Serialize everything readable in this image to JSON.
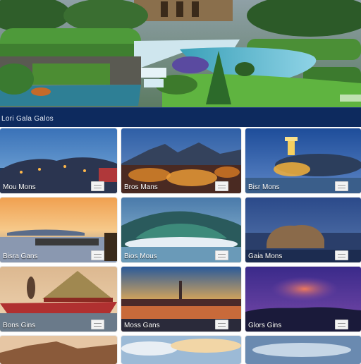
{
  "banner": {
    "title": "Lori Gala Galos"
  },
  "cards": [
    {
      "caption": "Mou Mons"
    },
    {
      "caption": "Bros Mans"
    },
    {
      "caption": "Bisr Mons"
    },
    {
      "caption": "Bisra Gans"
    },
    {
      "caption": "Bios Mous"
    },
    {
      "caption": "Gaia Mons"
    },
    {
      "caption": "Bons Gins"
    },
    {
      "caption": "Moss Gans"
    },
    {
      "caption": "Glors Gins"
    },
    {
      "caption": ""
    },
    {
      "caption": ""
    },
    {
      "caption": ""
    }
  ]
}
